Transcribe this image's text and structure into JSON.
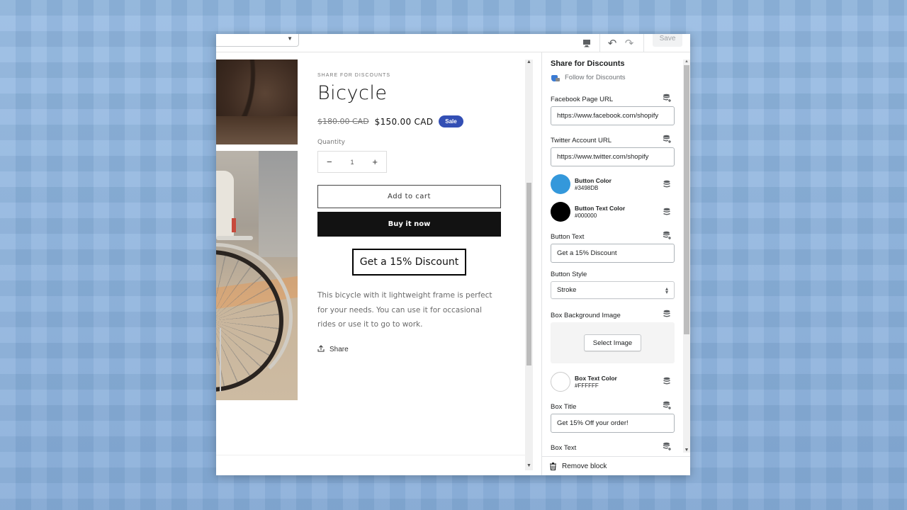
{
  "topbar": {
    "template_select": "",
    "device_icon": "desktop-icon",
    "undo_icon": "undo-icon",
    "redo_icon": "redo-icon",
    "save_label": "Save"
  },
  "preview": {
    "vendor": "SHARE FOR DISCOUNTS",
    "title": "Bicycle",
    "price_old": "$180.00 CAD",
    "price_new": "$150.00 CAD",
    "sale_badge": "Sale",
    "quantity_label": "Quantity",
    "quantity_value": "1",
    "minus": "−",
    "plus": "+",
    "add_to_cart": "Add to cart",
    "buy_now": "Buy it now",
    "discount_button": "Get a 15% Discount",
    "description": "This bicycle with it lightweight frame is perfect for your needs. You can use it for occasional rides or use it to go to work.",
    "share_label": "Share"
  },
  "sidebar": {
    "title": "Share for Discounts",
    "app_name": "Follow for Discounts",
    "fields": {
      "facebook_label": "Facebook Page URL",
      "facebook_value": "https://www.facebook.com/shopify",
      "twitter_label": "Twitter Account URL",
      "twitter_value": "https://www.twitter.com/shopify",
      "button_color_label": "Button Color",
      "button_color_value": "#3498DB",
      "button_text_color_label": "Button Text Color",
      "button_text_color_value": "#000000",
      "button_text_label": "Button Text",
      "button_text_value": "Get a 15% Discount",
      "button_style_label": "Button Style",
      "button_style_value": "Stroke",
      "box_bg_label": "Box Background Image",
      "select_image": "Select Image",
      "box_text_color_label": "Box Text Color",
      "box_text_color_value": "#FFFFFF",
      "box_title_label": "Box Title",
      "box_title_value": "Get 15% Off your order!",
      "box_text_label": "Box Text"
    },
    "remove_block": "Remove block"
  },
  "colors": {
    "sale_badge": "#334FB4",
    "button_color_swatch": "#3498DB",
    "button_text_color_swatch": "#000000",
    "box_text_color_swatch": "#FFFFFF"
  }
}
